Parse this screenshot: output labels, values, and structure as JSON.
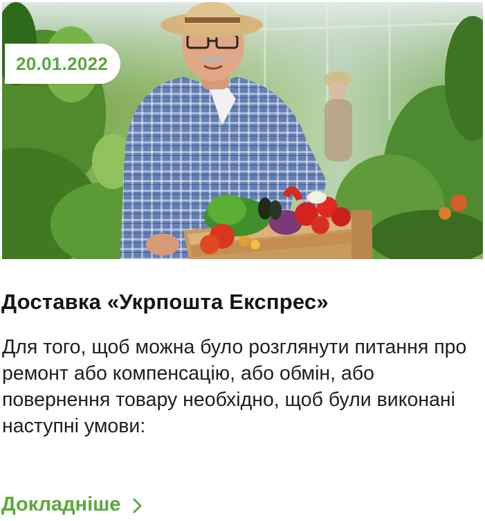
{
  "card": {
    "date": "20.01.2022",
    "title": "Доставка «Укрпошта Експрес»",
    "description": "Для того, щоб можна було розглянути питання про ремонт або компенсацію, або обмін, або повернення товару необхідно, щоб були виконані наступні умови:",
    "more_link": "Докладніше",
    "more_icon": "chevron-right-icon"
  },
  "colors": {
    "accent": "#58a83a",
    "text": "#141414"
  }
}
